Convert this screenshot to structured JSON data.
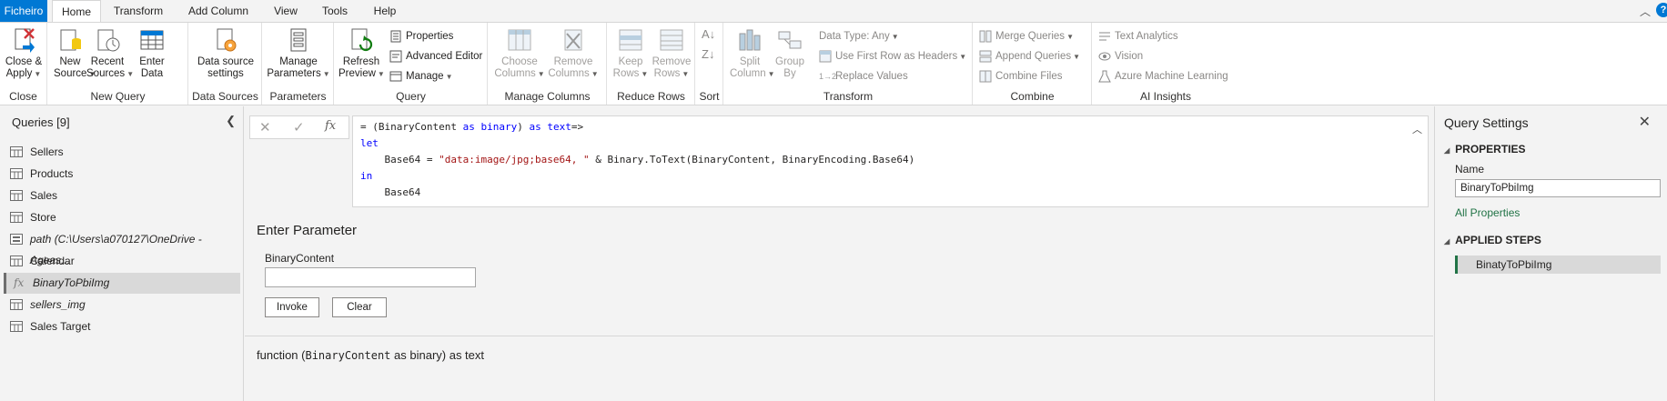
{
  "tabs": {
    "file": "Ficheiro",
    "home": "Home",
    "transform": "Transform",
    "add_column": "Add Column",
    "view": "View",
    "tools": "Tools",
    "help": "Help"
  },
  "ribbon": {
    "close_group": {
      "label": "Close",
      "close_apply": "Close &",
      "close_apply2": "Apply"
    },
    "new_query_group": {
      "label": "New Query",
      "new_source": "New",
      "new_source2": "Source",
      "recent_sources": "Recent",
      "recent_sources2": "Sources",
      "enter_data": "Enter",
      "enter_data2": "Data"
    },
    "data_sources_group": {
      "label": "Data Sources",
      "settings": "Data source",
      "settings2": "settings"
    },
    "parameters_group": {
      "label": "Parameters",
      "manage": "Manage",
      "manage2": "Parameters"
    },
    "query_group": {
      "label": "Query",
      "refresh": "Refresh",
      "refresh2": "Preview",
      "properties": "Properties",
      "advanced_editor": "Advanced Editor",
      "manage": "Manage"
    },
    "manage_columns_group": {
      "label": "Manage Columns",
      "choose": "Choose",
      "choose2": "Columns",
      "remove": "Remove",
      "remove2": "Columns"
    },
    "reduce_rows_group": {
      "label": "Reduce Rows",
      "keep": "Keep",
      "keep2": "Rows",
      "remove": "Remove",
      "remove2": "Rows"
    },
    "sort_group": {
      "label": "Sort"
    },
    "transform_group": {
      "label": "Transform",
      "split": "Split",
      "split2": "Column",
      "group": "Group",
      "group2": "By",
      "data_type": "Data Type: Any",
      "first_row": "Use First Row as Headers",
      "replace": "Replace Values"
    },
    "combine_group": {
      "label": "Combine",
      "merge": "Merge Queries",
      "append": "Append Queries",
      "combine_files": "Combine Files"
    },
    "ai_group": {
      "label": "AI Insights",
      "text_analytics": "Text Analytics",
      "vision": "Vision",
      "azure_ml": "Azure Machine Learning"
    }
  },
  "queries": {
    "header": "Queries [9]",
    "items": [
      {
        "label": "Sellers"
      },
      {
        "label": "Products"
      },
      {
        "label": "Sales"
      },
      {
        "label": "Store"
      },
      {
        "label": "path (C:\\Users\\a070127\\OneDrive - Ageas..."
      },
      {
        "label": "Calendar"
      },
      {
        "label": "BinaryToPbiImg"
      },
      {
        "label": "sellers_img"
      },
      {
        "label": "Sales Target"
      }
    ]
  },
  "formula_bar": {
    "cancel": "✕",
    "commit": "✓",
    "fx": "fx",
    "line1_a": "= (BinaryContent ",
    "line1_as": "as",
    "line1_b": " ",
    "line1_binary": "binary",
    "line1_c": ") ",
    "line1_as2": "as",
    "line1_d": " ",
    "line1_text": "text",
    "line1_e": "=>",
    "line2": "let",
    "line3_a": "    Base64 = ",
    "line3_str": "\"data:image/jpg;base64, \"",
    "line3_b": " & Binary.ToText(BinaryContent, BinaryEncoding.Base64)",
    "line4": "in",
    "line5": "    Base64"
  },
  "parameter": {
    "title": "Enter Parameter",
    "label": "BinaryContent",
    "value": "",
    "invoke": "Invoke",
    "clear": "Clear"
  },
  "signature": {
    "prefix": "function (",
    "param": "BinaryContent",
    "suffix": " as binary) as text"
  },
  "query_settings": {
    "title": "Query Settings",
    "properties": "PROPERTIES",
    "name_label": "Name",
    "name_value": "BinaryToPbiImg",
    "all_properties": "All Properties",
    "applied_steps": "APPLIED STEPS",
    "steps": [
      "BinatyToPbiImg"
    ]
  },
  "colors": {
    "accent_blue": "#0078d4",
    "accent_green": "#217346",
    "keyword": "#0000ff",
    "string": "#a31515"
  }
}
